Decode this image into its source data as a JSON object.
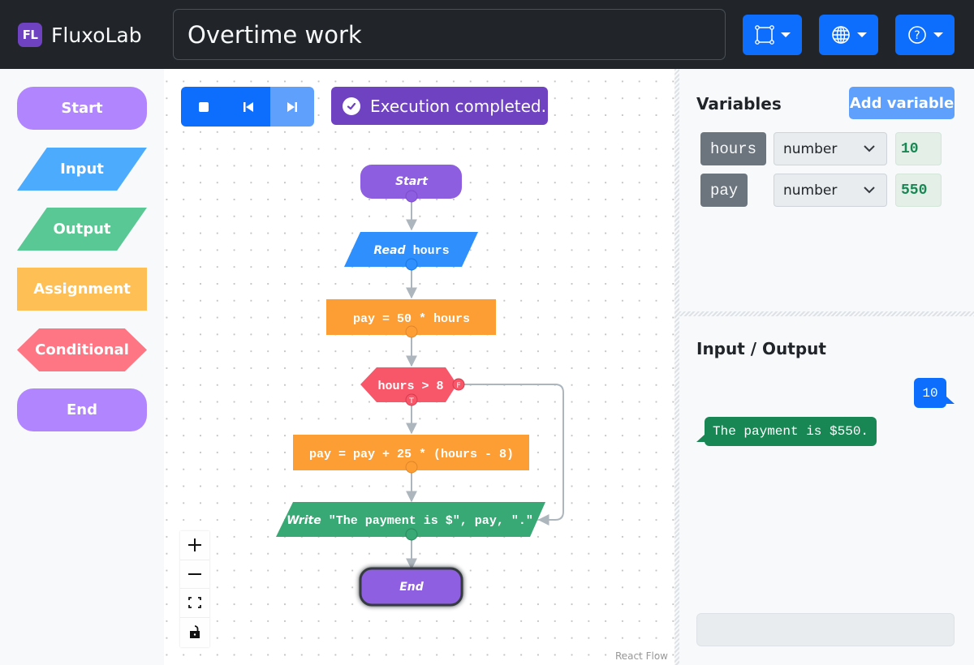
{
  "app": {
    "logo_text": "FL",
    "name": "FluxoLab",
    "program_title": "Overtime work"
  },
  "navbar": {
    "buttons": [
      {
        "name": "shape-menu",
        "icon": "bounding-box-icon"
      },
      {
        "name": "language-menu",
        "icon": "globe-icon"
      },
      {
        "name": "help-menu",
        "icon": "question-circle-icon"
      }
    ]
  },
  "palette": {
    "items": [
      {
        "label": "Start",
        "shape": "rounded",
        "color": "#b185fd"
      },
      {
        "label": "Input",
        "shape": "parallelogram",
        "color": "#4dabfd"
      },
      {
        "label": "Output",
        "shape": "parallelogram",
        "color": "#5ac894"
      },
      {
        "label": "Assignment",
        "shape": "rectangle",
        "color": "#fec055"
      },
      {
        "label": "Conditional",
        "shape": "hexagon",
        "color": "#fe7584"
      },
      {
        "label": "End",
        "shape": "rounded",
        "color": "#b185fd"
      }
    ]
  },
  "execution": {
    "controls": [
      {
        "name": "stop",
        "icon": "stop-icon"
      },
      {
        "name": "reset",
        "icon": "skip-start-icon"
      },
      {
        "name": "step",
        "icon": "skip-end-icon",
        "disabled": true
      }
    ],
    "status": "Execution completed."
  },
  "flowchart": {
    "nodes": [
      {
        "id": "start",
        "type": "start",
        "keyword": "Start",
        "text": "",
        "color": "#8e5ee0"
      },
      {
        "id": "read",
        "type": "input",
        "keyword": "Read",
        "text": "hours",
        "color": "#2e8ffd"
      },
      {
        "id": "assign1",
        "type": "assignment",
        "keyword": "",
        "text": "pay = 50 * hours",
        "color": "#fd9e35"
      },
      {
        "id": "cond",
        "type": "conditional",
        "keyword": "",
        "text": "hours > 8",
        "color": "#f8576a"
      },
      {
        "id": "assign2",
        "type": "assignment",
        "keyword": "",
        "text": "pay = pay + 25 * (hours - 8)",
        "color": "#fd9e35"
      },
      {
        "id": "write",
        "type": "output",
        "keyword": "Write",
        "text": "\"The payment is $\", pay, \".\"",
        "color": "#38a874"
      },
      {
        "id": "end",
        "type": "end",
        "keyword": "End",
        "text": "",
        "color": "#8e5ee0",
        "active": true
      }
    ],
    "branch_labels": {
      "true": "T",
      "false": "F"
    },
    "edge_color": "#adb5bd"
  },
  "zoom_controls": [
    {
      "name": "zoom-in",
      "icon": "plus-icon"
    },
    {
      "name": "zoom-out",
      "icon": "minus-icon"
    },
    {
      "name": "fit-view",
      "icon": "fit-view-icon"
    },
    {
      "name": "toggle-interactivity",
      "icon": "unlock-icon"
    }
  ],
  "attribution": "React Flow",
  "variables": {
    "title": "Variables",
    "add_label": "Add variable",
    "items": [
      {
        "name": "hours",
        "type": "number",
        "value": "10"
      },
      {
        "name": "pay",
        "type": "number",
        "value": "550"
      }
    ]
  },
  "io": {
    "title": "Input / Output",
    "messages": [
      {
        "direction": "input",
        "text": "10"
      },
      {
        "direction": "output",
        "text": "The payment is $550."
      }
    ],
    "input_value": ""
  }
}
